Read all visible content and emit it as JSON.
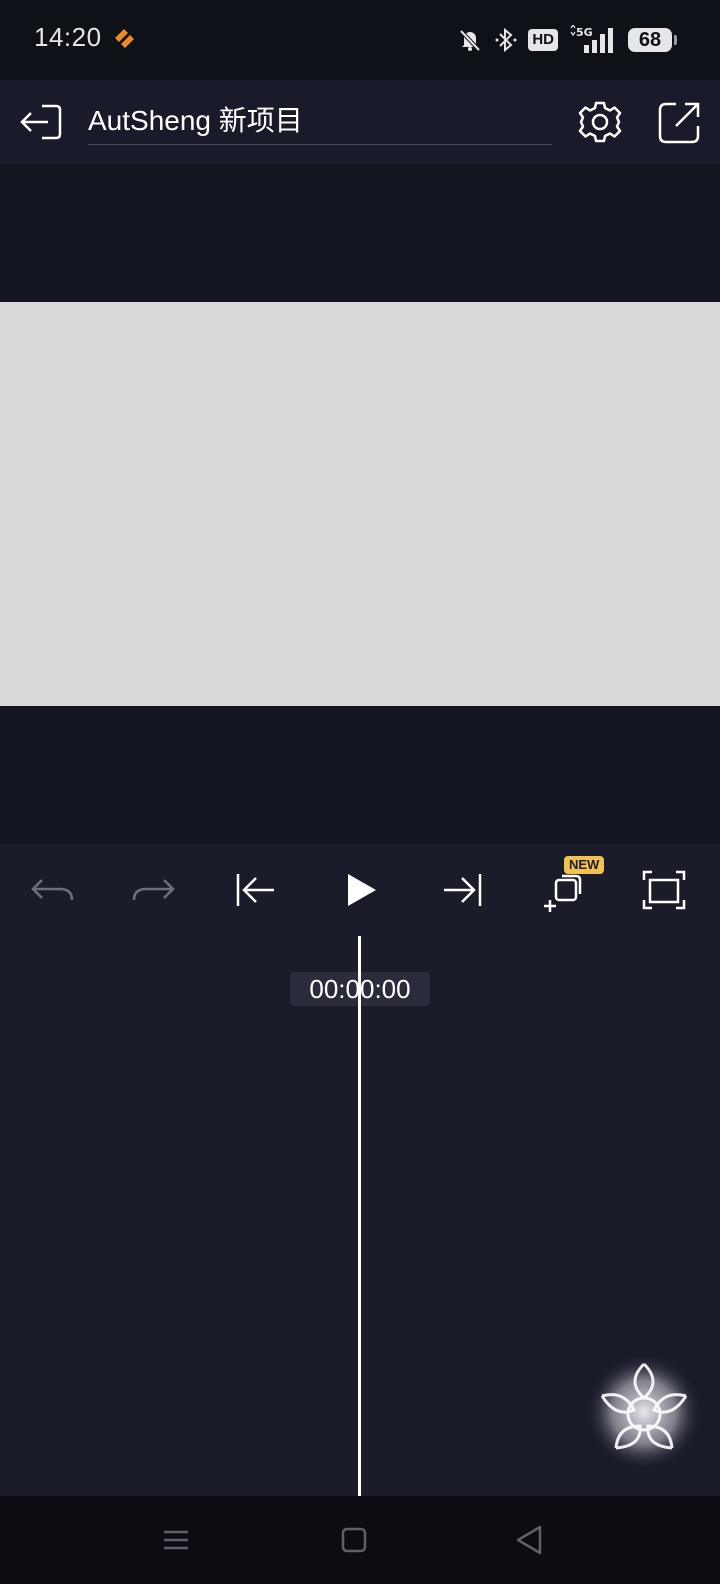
{
  "status_bar": {
    "time": "14:20",
    "hd_label": "HD",
    "network_label": "5G",
    "battery": "68",
    "icons": [
      "orange-app-icon",
      "bell-muted-icon",
      "bluetooth-icon",
      "hd-icon",
      "5g-signal-icon",
      "battery-icon"
    ]
  },
  "toolbar": {
    "project_title": "AutSheng 新项目",
    "icons": [
      "exit-icon",
      "gear-icon",
      "share-external-icon"
    ]
  },
  "preview": {
    "background_color": "#d9d9d9"
  },
  "controls": {
    "new_badge": "NEW",
    "icons": [
      "undo-icon",
      "redo-icon",
      "skip-to-start-icon",
      "play-icon",
      "skip-to-end-icon",
      "add-layer-icon",
      "fullscreen-icon"
    ]
  },
  "timeline": {
    "timecode": "00:00:00"
  },
  "nav_bar": {
    "icons": [
      "menu-icon",
      "home-icon",
      "back-icon"
    ]
  },
  "colors": {
    "background": "#1b1c2a",
    "accent_badge": "#f2c14e",
    "app_icon": "#f08a24"
  }
}
